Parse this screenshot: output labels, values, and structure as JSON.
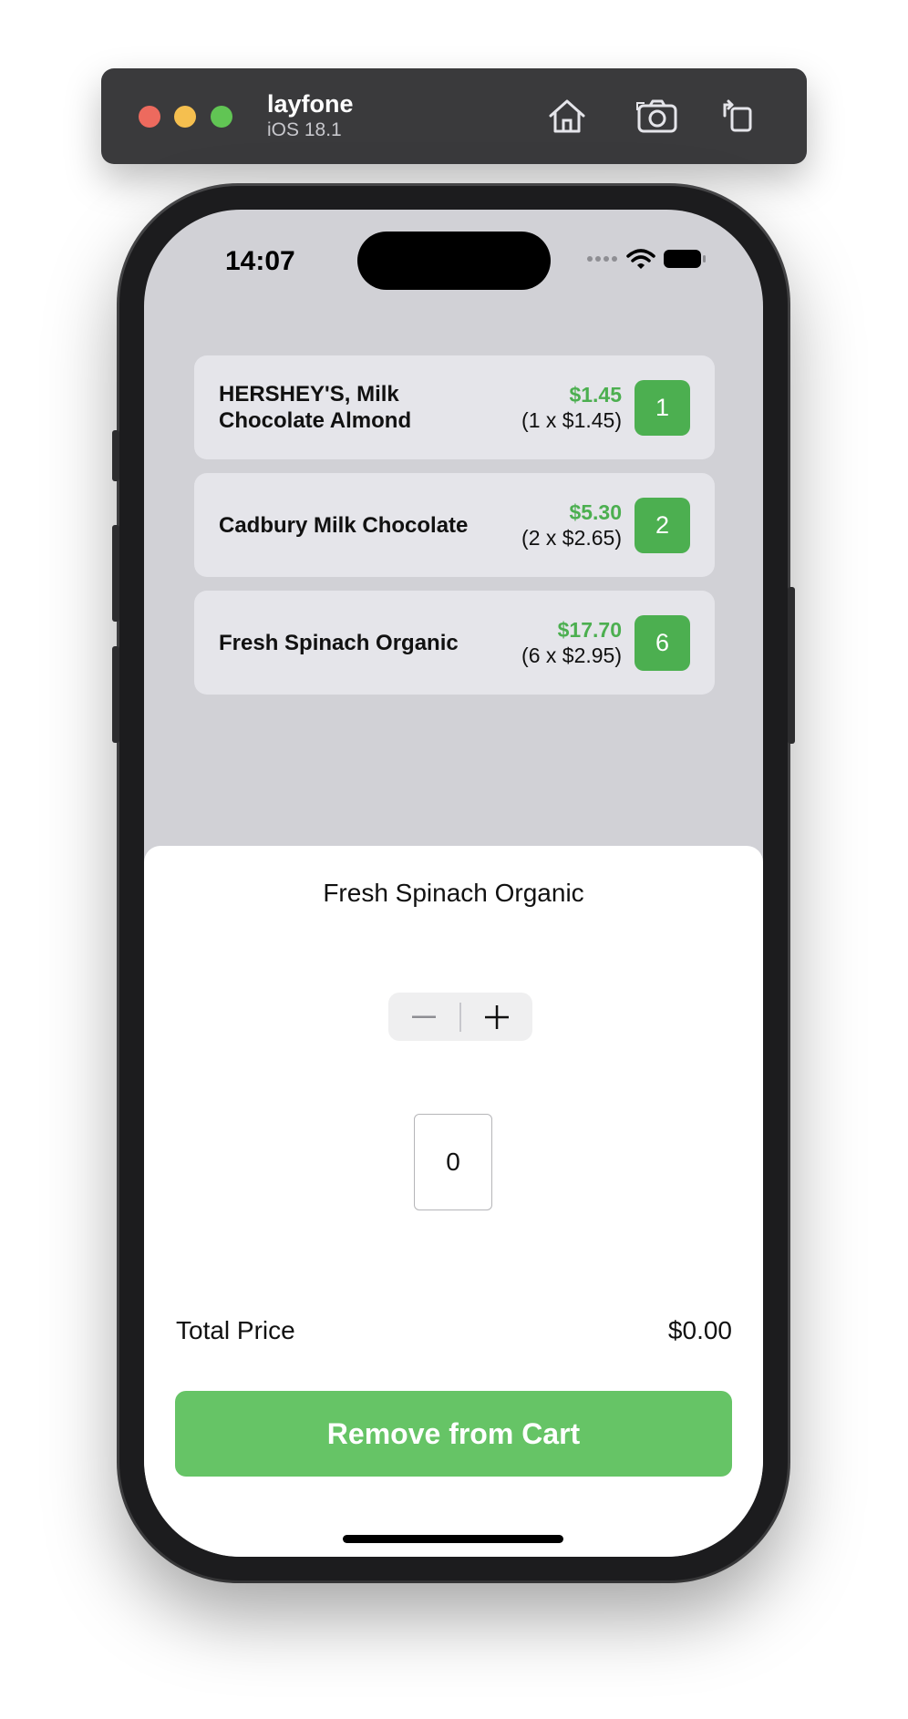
{
  "simulator": {
    "device_name": "layfone",
    "os_version": "iOS 18.1"
  },
  "status_bar": {
    "time": "14:07"
  },
  "cart": {
    "items": [
      {
        "name": "HERSHEY'S, Milk Chocolate Almond",
        "total": "$1.45",
        "detail": "(1 x $1.45)",
        "quantity": "1"
      },
      {
        "name": "Cadbury Milk Chocolate",
        "total": "$5.30",
        "detail": "(2 x $2.65)",
        "quantity": "2"
      },
      {
        "name": "Fresh Spinach Organic",
        "total": "$17.70",
        "detail": "(6 x $2.95)",
        "quantity": "6"
      }
    ]
  },
  "sheet": {
    "title": "Fresh Spinach Organic",
    "quantity_value": "0",
    "total_label": "Total Price",
    "total_value": "$0.00",
    "remove_label": "Remove from Cart"
  },
  "colors": {
    "accent_green": "#4caf50",
    "button_green": "#66c466",
    "screen_background": "#d1d1d6"
  },
  "icons": {
    "home": "home-icon",
    "screenshot": "camera-icon",
    "rotate": "rotate-icon",
    "minus": "minus-icon",
    "plus": "plus-icon"
  }
}
